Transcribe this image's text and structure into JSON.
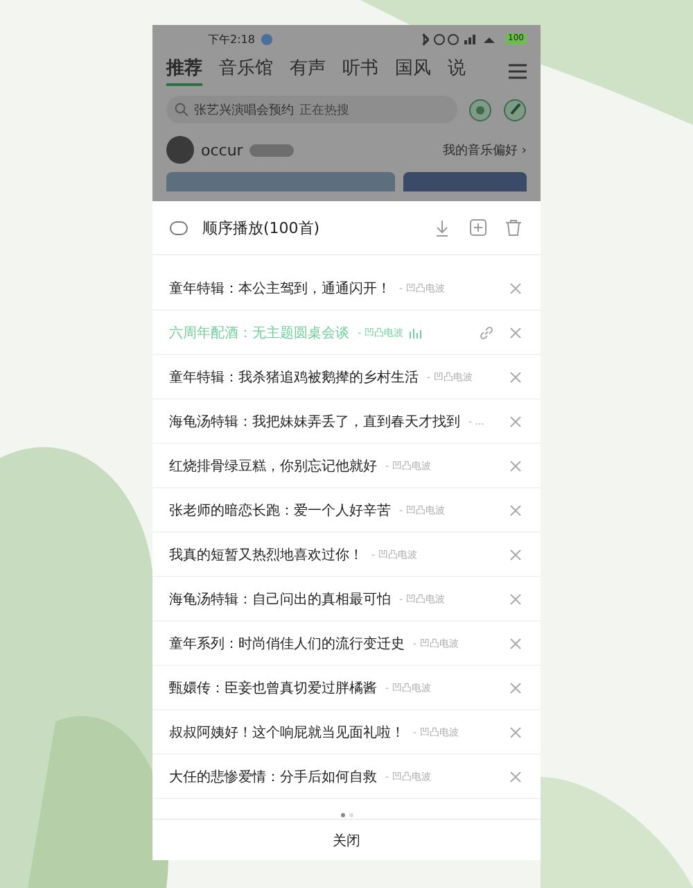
{
  "status_bar": {
    "time": "下午2:18",
    "battery": "100"
  },
  "tabs": [
    {
      "label": "推荐",
      "selected": true
    },
    {
      "label": "音乐馆",
      "selected": false
    },
    {
      "label": "有声",
      "selected": false
    },
    {
      "label": "听书",
      "selected": false
    },
    {
      "label": "国风",
      "selected": false
    },
    {
      "label": "说",
      "selected": false
    }
  ],
  "search": {
    "placeholder": "张艺兴演唱会预约",
    "hint": "正在热搜"
  },
  "user": {
    "name": "occur",
    "link": "我的音乐偏好 ›"
  },
  "playlist": {
    "mode": "顺序播放(100首)",
    "tracks": [
      {
        "title": "童年特辑：本公主驾到，通通闪开！",
        "artist": "- 凹凸电波",
        "playing": false
      },
      {
        "title": "六周年配酒：无主题圆桌会谈",
        "artist": "- 凹凸电波",
        "playing": true
      },
      {
        "title": "童年特辑：我杀猪追鸡被鹅撵的乡村生活",
        "artist": "- 凹凸电波",
        "playing": false
      },
      {
        "title": "海龟汤特辑：我把妹妹弄丢了，直到春天才找到",
        "artist": "- ...",
        "playing": false
      },
      {
        "title": "红烧排骨绿豆糕，你别忘记他就好",
        "artist": "- 凹凸电波",
        "playing": false
      },
      {
        "title": "张老师的暗恋长跑：爱一个人好辛苦",
        "artist": "- 凹凸电波",
        "playing": false
      },
      {
        "title": "我真的短暂又热烈地喜欢过你！",
        "artist": "- 凹凸电波",
        "playing": false
      },
      {
        "title": "海龟汤特辑：自己问出的真相最可怕",
        "artist": "- 凹凸电波",
        "playing": false
      },
      {
        "title": "童年系列：时尚俏佳人们的流行变迁史",
        "artist": "- 凹凸电波",
        "playing": false
      },
      {
        "title": "甄嬛传：臣妾也曾真切爱过胖橘酱",
        "artist": "- 凹凸电波",
        "playing": false
      },
      {
        "title": "叔叔阿姨好！这个响屁就当见面礼啦！",
        "artist": "- 凹凸电波",
        "playing": false
      },
      {
        "title": "大任的悲惨爱情：分手后如何自救",
        "artist": "- 凹凸电波",
        "playing": false
      }
    ],
    "pages": [
      {
        "selected": true
      },
      {
        "selected": false
      }
    ],
    "close": "关闭"
  }
}
